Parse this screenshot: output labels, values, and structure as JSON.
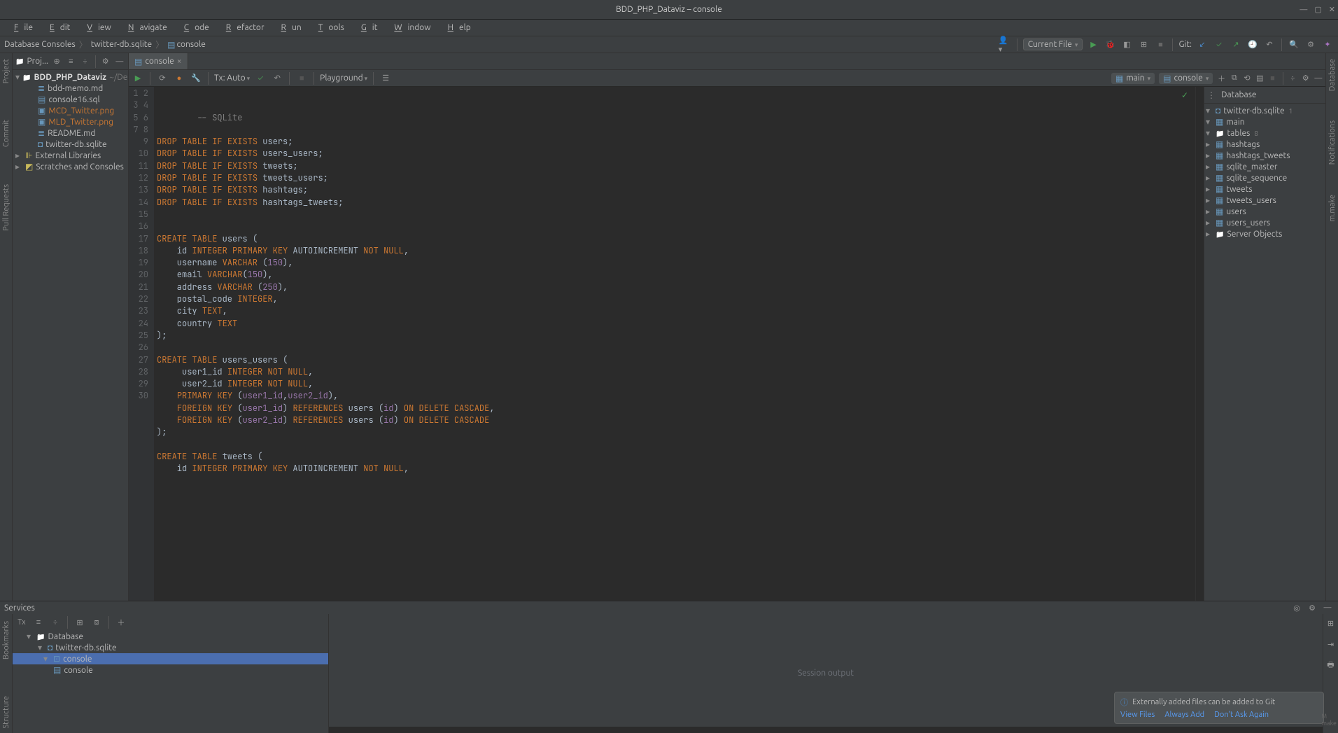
{
  "title": "BDD_PHP_Dataviz – console",
  "menu": [
    "File",
    "Edit",
    "View",
    "Navigate",
    "Code",
    "Refactor",
    "Run",
    "Tools",
    "Git",
    "Window",
    "Help"
  ],
  "breadcrumbs": [
    "Database Consoles",
    "twitter-db.sqlite",
    "console"
  ],
  "runConfig": "Current File",
  "gitLabel": "Git:",
  "leftTabs": [
    "Project",
    "Commit",
    "Pull Requests"
  ],
  "rightTabs": [
    "Database",
    "Notifications",
    "m.make"
  ],
  "lowerLeftTabs": [
    "Bookmarks",
    "Structure"
  ],
  "project": {
    "label": "Proj...",
    "root": "BDD_PHP_Dataviz",
    "rootSuffix": "~/Des",
    "files": [
      "bdd-memo.md",
      "console16.sql",
      "MCD_Twitter.png",
      "MLD_Twitter.png",
      "README.md",
      "twitter-db.sqlite"
    ],
    "externalLibs": "External Libraries",
    "scratches": "Scratches and Consoles"
  },
  "editor": {
    "tab": "console",
    "txAuto": "Tx: Auto",
    "playground": "Playground",
    "mainTarget": "main",
    "consoleTarget": "console"
  },
  "databasePanel": {
    "title": "Database",
    "db": "twitter-db.sqlite",
    "dbBadge": "1",
    "main": "main",
    "tablesLabel": "tables",
    "tablesCount": "8",
    "tables": [
      "hashtags",
      "hashtags_tweets",
      "sqlite_master",
      "sqlite_sequence",
      "tweets",
      "tweets_users",
      "users",
      "users_users"
    ],
    "serverObjects": "Server Objects"
  },
  "services": {
    "title": "Services",
    "database": "Database",
    "twitter": "twitter-db.sqlite",
    "consoleNode": "console",
    "consoleLeaf": "console",
    "output": "Session output"
  },
  "notification": {
    "title": "Externally added files can be added to Git",
    "viewFiles": "View Files",
    "alwaysAdd": "Always Add",
    "dontAsk": "Don't Ask Again"
  },
  "code": [
    {
      "t": "comment",
      "v": "-- SQLite"
    },
    {
      "t": "blank"
    },
    {
      "t": "drop",
      "tbl": "users"
    },
    {
      "t": "drop",
      "tbl": "users_users"
    },
    {
      "t": "drop",
      "tbl": "tweets"
    },
    {
      "t": "drop",
      "tbl": "tweets_users"
    },
    {
      "t": "drop",
      "tbl": "hashtags"
    },
    {
      "t": "drop",
      "tbl": "hashtags_tweets"
    },
    {
      "t": "blank"
    },
    {
      "t": "blank"
    },
    {
      "t": "createOpen",
      "tbl": "users"
    },
    {
      "t": "col",
      "raw": "    id <k>INTEGER</k> <k>PRIMARY</k> <k>KEY</k> AUTOINCREMENT <k>NOT</k> <k>NULL</k>,"
    },
    {
      "t": "col",
      "raw": "    username <k>VARCHAR</k> (<n>150</n>),"
    },
    {
      "t": "col",
      "raw": "    email <k>VARCHAR</k>(<n>150</n>),"
    },
    {
      "t": "col",
      "raw": "    address <k>VARCHAR</k> (<n>250</n>),"
    },
    {
      "t": "col",
      "raw": "    postal_code <k>INTEGER</k>,"
    },
    {
      "t": "col",
      "raw": "    city <k>TEXT</k>,"
    },
    {
      "t": "col",
      "raw": "    country <k>TEXT</k>"
    },
    {
      "t": "close"
    },
    {
      "t": "blank"
    },
    {
      "t": "createOpen",
      "tbl": "users_users"
    },
    {
      "t": "col",
      "raw": "     user1_id <k>INTEGER</k> <k>NOT</k> <k>NULL</k>,"
    },
    {
      "t": "col",
      "raw": "     user2_id <k>INTEGER</k> <k>NOT</k> <k>NULL</k>,"
    },
    {
      "t": "col",
      "raw": "    <k>PRIMARY</k> <k>KEY</k> (<col-ref>user1_id</col-ref>,<col-ref>user2_id</col-ref>),"
    },
    {
      "t": "col",
      "raw": "    <k>FOREIGN</k> <k>KEY</k> (<col-ref>user1_id</col-ref>) <k>REFERENCES</k> users (<col-ref>id</col-ref>) <k>ON</k> <k>DELETE</k> <k>CASCADE</k>,"
    },
    {
      "t": "col",
      "raw": "    <k>FOREIGN</k> <k>KEY</k> (<col-ref>user2_id</col-ref>) <k>REFERENCES</k> users (<col-ref>id</col-ref>) <k>ON</k> <k>DELETE</k> <k>CASCADE</k>"
    },
    {
      "t": "close"
    },
    {
      "t": "blank"
    },
    {
      "t": "createOpen",
      "tbl": "tweets"
    },
    {
      "t": "col",
      "raw": "    id <k>INTEGER</k> <k>PRIMARY</k> <k>KEY</k> AUTOINCREMENT <k>NOT</k> <k>NULL</k>,"
    }
  ]
}
